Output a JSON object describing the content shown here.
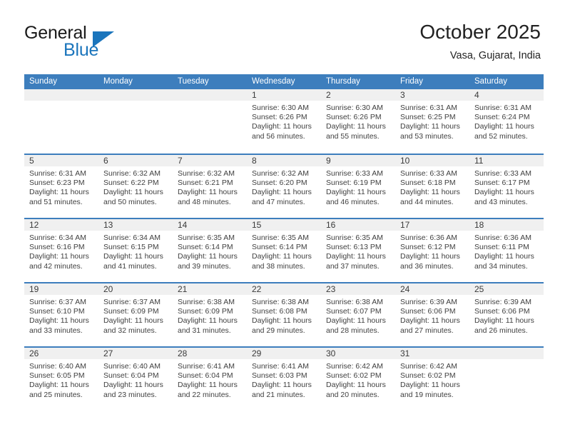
{
  "brand": {
    "line1": "General",
    "line2": "Blue",
    "triangle_icon": "triangle-icon",
    "accent_color": "#1b75bc"
  },
  "header": {
    "title": "October 2025",
    "subtitle": "Vasa, Gujarat, India"
  },
  "colors": {
    "header_blue": "#3d7ebd",
    "day_band_gray": "#f0f0f0",
    "text": "#404040"
  },
  "weekdays": [
    "Sunday",
    "Monday",
    "Tuesday",
    "Wednesday",
    "Thursday",
    "Friday",
    "Saturday"
  ],
  "weeks": [
    [
      {
        "day": "",
        "lines": []
      },
      {
        "day": "",
        "lines": []
      },
      {
        "day": "",
        "lines": []
      },
      {
        "day": "1",
        "lines": [
          "Sunrise: 6:30 AM",
          "Sunset: 6:26 PM",
          "Daylight: 11 hours",
          "and 56 minutes."
        ]
      },
      {
        "day": "2",
        "lines": [
          "Sunrise: 6:30 AM",
          "Sunset: 6:26 PM",
          "Daylight: 11 hours",
          "and 55 minutes."
        ]
      },
      {
        "day": "3",
        "lines": [
          "Sunrise: 6:31 AM",
          "Sunset: 6:25 PM",
          "Daylight: 11 hours",
          "and 53 minutes."
        ]
      },
      {
        "day": "4",
        "lines": [
          "Sunrise: 6:31 AM",
          "Sunset: 6:24 PM",
          "Daylight: 11 hours",
          "and 52 minutes."
        ]
      }
    ],
    [
      {
        "day": "5",
        "lines": [
          "Sunrise: 6:31 AM",
          "Sunset: 6:23 PM",
          "Daylight: 11 hours",
          "and 51 minutes."
        ]
      },
      {
        "day": "6",
        "lines": [
          "Sunrise: 6:32 AM",
          "Sunset: 6:22 PM",
          "Daylight: 11 hours",
          "and 50 minutes."
        ]
      },
      {
        "day": "7",
        "lines": [
          "Sunrise: 6:32 AM",
          "Sunset: 6:21 PM",
          "Daylight: 11 hours",
          "and 48 minutes."
        ]
      },
      {
        "day": "8",
        "lines": [
          "Sunrise: 6:32 AM",
          "Sunset: 6:20 PM",
          "Daylight: 11 hours",
          "and 47 minutes."
        ]
      },
      {
        "day": "9",
        "lines": [
          "Sunrise: 6:33 AM",
          "Sunset: 6:19 PM",
          "Daylight: 11 hours",
          "and 46 minutes."
        ]
      },
      {
        "day": "10",
        "lines": [
          "Sunrise: 6:33 AM",
          "Sunset: 6:18 PM",
          "Daylight: 11 hours",
          "and 44 minutes."
        ]
      },
      {
        "day": "11",
        "lines": [
          "Sunrise: 6:33 AM",
          "Sunset: 6:17 PM",
          "Daylight: 11 hours",
          "and 43 minutes."
        ]
      }
    ],
    [
      {
        "day": "12",
        "lines": [
          "Sunrise: 6:34 AM",
          "Sunset: 6:16 PM",
          "Daylight: 11 hours",
          "and 42 minutes."
        ]
      },
      {
        "day": "13",
        "lines": [
          "Sunrise: 6:34 AM",
          "Sunset: 6:15 PM",
          "Daylight: 11 hours",
          "and 41 minutes."
        ]
      },
      {
        "day": "14",
        "lines": [
          "Sunrise: 6:35 AM",
          "Sunset: 6:14 PM",
          "Daylight: 11 hours",
          "and 39 minutes."
        ]
      },
      {
        "day": "15",
        "lines": [
          "Sunrise: 6:35 AM",
          "Sunset: 6:14 PM",
          "Daylight: 11 hours",
          "and 38 minutes."
        ]
      },
      {
        "day": "16",
        "lines": [
          "Sunrise: 6:35 AM",
          "Sunset: 6:13 PM",
          "Daylight: 11 hours",
          "and 37 minutes."
        ]
      },
      {
        "day": "17",
        "lines": [
          "Sunrise: 6:36 AM",
          "Sunset: 6:12 PM",
          "Daylight: 11 hours",
          "and 36 minutes."
        ]
      },
      {
        "day": "18",
        "lines": [
          "Sunrise: 6:36 AM",
          "Sunset: 6:11 PM",
          "Daylight: 11 hours",
          "and 34 minutes."
        ]
      }
    ],
    [
      {
        "day": "19",
        "lines": [
          "Sunrise: 6:37 AM",
          "Sunset: 6:10 PM",
          "Daylight: 11 hours",
          "and 33 minutes."
        ]
      },
      {
        "day": "20",
        "lines": [
          "Sunrise: 6:37 AM",
          "Sunset: 6:09 PM",
          "Daylight: 11 hours",
          "and 32 minutes."
        ]
      },
      {
        "day": "21",
        "lines": [
          "Sunrise: 6:38 AM",
          "Sunset: 6:09 PM",
          "Daylight: 11 hours",
          "and 31 minutes."
        ]
      },
      {
        "day": "22",
        "lines": [
          "Sunrise: 6:38 AM",
          "Sunset: 6:08 PM",
          "Daylight: 11 hours",
          "and 29 minutes."
        ]
      },
      {
        "day": "23",
        "lines": [
          "Sunrise: 6:38 AM",
          "Sunset: 6:07 PM",
          "Daylight: 11 hours",
          "and 28 minutes."
        ]
      },
      {
        "day": "24",
        "lines": [
          "Sunrise: 6:39 AM",
          "Sunset: 6:06 PM",
          "Daylight: 11 hours",
          "and 27 minutes."
        ]
      },
      {
        "day": "25",
        "lines": [
          "Sunrise: 6:39 AM",
          "Sunset: 6:06 PM",
          "Daylight: 11 hours",
          "and 26 minutes."
        ]
      }
    ],
    [
      {
        "day": "26",
        "lines": [
          "Sunrise: 6:40 AM",
          "Sunset: 6:05 PM",
          "Daylight: 11 hours",
          "and 25 minutes."
        ]
      },
      {
        "day": "27",
        "lines": [
          "Sunrise: 6:40 AM",
          "Sunset: 6:04 PM",
          "Daylight: 11 hours",
          "and 23 minutes."
        ]
      },
      {
        "day": "28",
        "lines": [
          "Sunrise: 6:41 AM",
          "Sunset: 6:04 PM",
          "Daylight: 11 hours",
          "and 22 minutes."
        ]
      },
      {
        "day": "29",
        "lines": [
          "Sunrise: 6:41 AM",
          "Sunset: 6:03 PM",
          "Daylight: 11 hours",
          "and 21 minutes."
        ]
      },
      {
        "day": "30",
        "lines": [
          "Sunrise: 6:42 AM",
          "Sunset: 6:02 PM",
          "Daylight: 11 hours",
          "and 20 minutes."
        ]
      },
      {
        "day": "31",
        "lines": [
          "Sunrise: 6:42 AM",
          "Sunset: 6:02 PM",
          "Daylight: 11 hours",
          "and 19 minutes."
        ]
      },
      {
        "day": "",
        "lines": []
      }
    ]
  ]
}
